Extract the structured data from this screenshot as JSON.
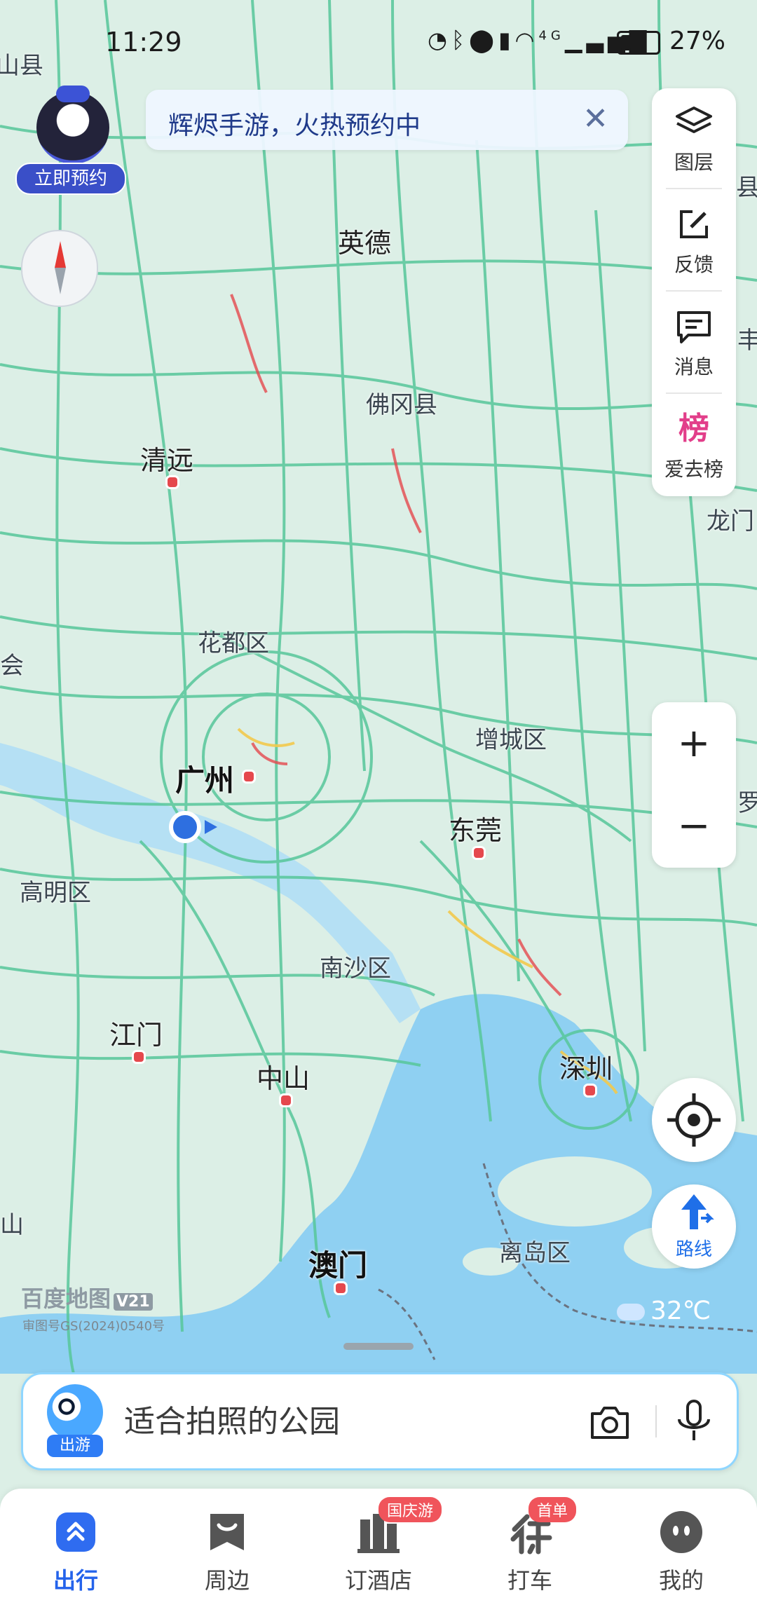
{
  "status_bar": {
    "time": "11:29",
    "network": "4G",
    "battery_percent": "27%",
    "battery_level": 0.27
  },
  "banner": {
    "text": "辉烬手游，火热预约中"
  },
  "reserve_badge": {
    "label": "立即预约"
  },
  "tools": [
    {
      "icon": "layers-icon",
      "label": "图层"
    },
    {
      "icon": "edit-feedback-icon",
      "label": "反馈"
    },
    {
      "icon": "message-icon",
      "label": "消息"
    },
    {
      "icon": "bang-icon",
      "label": "爱去榜",
      "glyph": "榜"
    }
  ],
  "zoom": {
    "in": "+",
    "out": "−"
  },
  "route_button": {
    "label": "路线"
  },
  "map_labels": {
    "shanxian": "山县",
    "yingde": "英德",
    "fogang": "佛冈县",
    "qingyuan": "清远",
    "huadu": "花都区",
    "hui": "会",
    "zengcheng": "增城区",
    "guangzhou": "广州",
    "dongguan": "东莞",
    "gaoming": "高明区",
    "nansha": "南沙区",
    "jiangmen": "江门",
    "zhongshan": "中山",
    "shenzhen": "深圳",
    "aomen": "澳门",
    "lidao": "离岛区",
    "longmen": "龙门",
    "xian": "县",
    "feng": "丰",
    "luo": "罗",
    "shan": "山"
  },
  "brand": {
    "name": "百度地图",
    "version": "V21",
    "approval": "审图号GS(2024)0540号"
  },
  "weather": {
    "temp": "32℃"
  },
  "search": {
    "placeholder": "适合拍照的公园",
    "mascot_tag": "出游"
  },
  "tabs": [
    {
      "label": "出行",
      "active": true
    },
    {
      "label": "周边"
    },
    {
      "label": "订酒店",
      "tag": "国庆游"
    },
    {
      "label": "打车",
      "tag": "首单"
    },
    {
      "label": "我的"
    }
  ],
  "colors": {
    "accent": "#2463eb",
    "land": "#dcefe6",
    "water": "#8fd0f2",
    "road": "#57c79a",
    "city_dot": "#e5484d"
  }
}
